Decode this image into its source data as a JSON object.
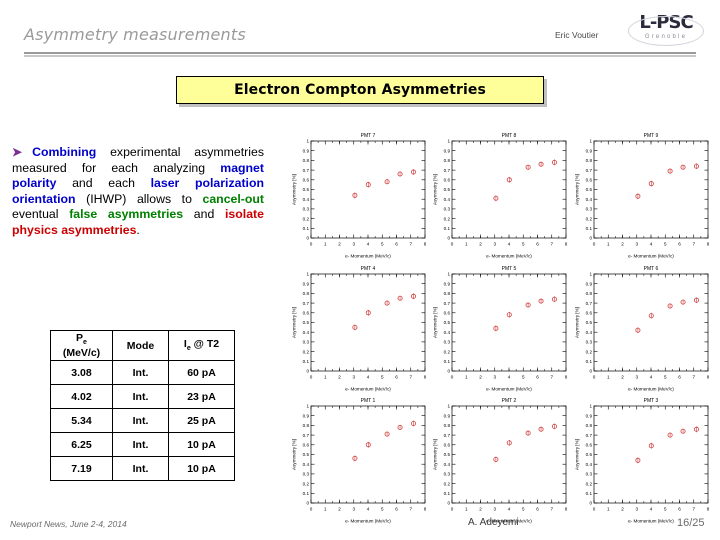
{
  "header": {
    "title": "Asymmetry measurements",
    "author": "Eric Voutier",
    "logo_main": "L-PSC",
    "logo_sub": "Grenoble"
  },
  "banner": {
    "text": "Electron Compton Asymmetries"
  },
  "paragraph": {
    "bullet": "➤",
    "seg1": "Combining",
    "seg2": " experimental asymmetries measured for each analyzing ",
    "seg3": "magnet polarity",
    "seg4": " and each ",
    "seg5": "laser polarization orientation",
    "seg6": " (IHWP) allows to ",
    "seg7": "cancel-out",
    "seg8": " eventual ",
    "seg9": "false asymmetries",
    "seg10": " and ",
    "seg11": "isolate physics asymmetries",
    "seg12": "."
  },
  "table": {
    "headers": [
      "P",
      "Mode",
      "I"
    ],
    "header_p_sub": "e",
    "header_p_unit": "(MeV/c)",
    "header_i_sub": "e",
    "header_i_rest": " @ T2",
    "rows": [
      {
        "p": "3.08",
        "mode": "Int.",
        "current": "60 pA"
      },
      {
        "p": "4.02",
        "mode": "Int.",
        "current": "23 pA"
      },
      {
        "p": "5.34",
        "mode": "Int.",
        "current": "25 pA"
      },
      {
        "p": "6.25",
        "mode": "Int.",
        "current": "10 pA"
      },
      {
        "p": "7.19",
        "mode": "Int.",
        "current": "10 pA"
      }
    ]
  },
  "chart_data": [
    {
      "type": "scatter",
      "title": "PMT 7",
      "xlabel": "e- Momentum (MeV/c)",
      "ylabel": "Asymmetry [%]",
      "xlim": [
        0,
        8
      ],
      "ylim": [
        0,
        1
      ],
      "xticks": [
        0,
        1,
        2,
        3,
        4,
        5,
        6,
        7,
        8
      ],
      "yticks": [
        0,
        0.1,
        0.2,
        0.3,
        0.4,
        0.5,
        0.6,
        0.7,
        0.8,
        0.9,
        1
      ],
      "grid": false,
      "marker_color": "#d04040",
      "x": [
        3.08,
        4.02,
        5.34,
        6.25,
        7.19
      ],
      "y": [
        0.44,
        0.55,
        0.58,
        0.66,
        0.68
      ],
      "yerr": [
        0.03,
        0.03,
        0.025,
        0.02,
        0.03
      ]
    },
    {
      "type": "scatter",
      "title": "PMT 8",
      "xlabel": "e- Momentum (MeV/c)",
      "ylabel": "Asymmetry [%]",
      "xlim": [
        0,
        8
      ],
      "ylim": [
        0,
        1
      ],
      "xticks": [
        0,
        1,
        2,
        3,
        4,
        5,
        6,
        7,
        8
      ],
      "yticks": [
        0,
        0.1,
        0.2,
        0.3,
        0.4,
        0.5,
        0.6,
        0.7,
        0.8,
        0.9,
        1
      ],
      "grid": false,
      "marker_color": "#d04040",
      "x": [
        3.08,
        4.02,
        5.34,
        6.25,
        7.19
      ],
      "y": [
        0.41,
        0.6,
        0.73,
        0.76,
        0.78
      ],
      "yerr": [
        0.03,
        0.03,
        0.025,
        0.02,
        0.03
      ]
    },
    {
      "type": "scatter",
      "title": "PMT 9",
      "xlabel": "e- Momentum (MeV/c)",
      "ylabel": "Asymmetry [%]",
      "xlim": [
        0,
        8
      ],
      "ylim": [
        0,
        1
      ],
      "xticks": [
        0,
        1,
        2,
        3,
        4,
        5,
        6,
        7,
        8
      ],
      "yticks": [
        0,
        0.1,
        0.2,
        0.3,
        0.4,
        0.5,
        0.6,
        0.7,
        0.8,
        0.9,
        1
      ],
      "grid": false,
      "marker_color": "#d04040",
      "x": [
        3.08,
        4.02,
        5.34,
        6.25,
        7.19
      ],
      "y": [
        0.43,
        0.56,
        0.69,
        0.73,
        0.74
      ],
      "yerr": [
        0.03,
        0.03,
        0.025,
        0.02,
        0.03
      ]
    },
    {
      "type": "scatter",
      "title": "PMT 4",
      "xlabel": "e- Momentum (MeV/c)",
      "ylabel": "Asymmetry [%]",
      "xlim": [
        0,
        8
      ],
      "ylim": [
        0,
        1
      ],
      "xticks": [
        0,
        1,
        2,
        3,
        4,
        5,
        6,
        7,
        8
      ],
      "yticks": [
        0,
        0.1,
        0.2,
        0.3,
        0.4,
        0.5,
        0.6,
        0.7,
        0.8,
        0.9,
        1
      ],
      "grid": false,
      "marker_color": "#d04040",
      "x": [
        3.08,
        4.02,
        5.34,
        6.25,
        7.19
      ],
      "y": [
        0.45,
        0.6,
        0.7,
        0.75,
        0.77
      ],
      "yerr": [
        0.03,
        0.03,
        0.025,
        0.02,
        0.03
      ]
    },
    {
      "type": "scatter",
      "title": "PMT 5",
      "xlabel": "e- Momentum (MeV/c)",
      "ylabel": "Asymmetry [%]",
      "xlim": [
        0,
        8
      ],
      "ylim": [
        0,
        1
      ],
      "xticks": [
        0,
        1,
        2,
        3,
        4,
        5,
        6,
        7,
        8
      ],
      "yticks": [
        0,
        0.1,
        0.2,
        0.3,
        0.4,
        0.5,
        0.6,
        0.7,
        0.8,
        0.9,
        1
      ],
      "grid": false,
      "marker_color": "#d04040",
      "x": [
        3.08,
        4.02,
        5.34,
        6.25,
        7.19
      ],
      "y": [
        0.44,
        0.58,
        0.68,
        0.72,
        0.74
      ],
      "yerr": [
        0.03,
        0.03,
        0.025,
        0.02,
        0.03
      ]
    },
    {
      "type": "scatter",
      "title": "PMT 6",
      "xlabel": "e- Momentum (MeV/c)",
      "ylabel": "Asymmetry [%]",
      "xlim": [
        0,
        8
      ],
      "ylim": [
        0,
        1
      ],
      "xticks": [
        0,
        1,
        2,
        3,
        4,
        5,
        6,
        7,
        8
      ],
      "yticks": [
        0,
        0.1,
        0.2,
        0.3,
        0.4,
        0.5,
        0.6,
        0.7,
        0.8,
        0.9,
        1
      ],
      "grid": false,
      "marker_color": "#d04040",
      "x": [
        3.08,
        4.02,
        5.34,
        6.25,
        7.19
      ],
      "y": [
        0.42,
        0.57,
        0.67,
        0.71,
        0.73
      ],
      "yerr": [
        0.03,
        0.03,
        0.025,
        0.02,
        0.03
      ]
    },
    {
      "type": "scatter",
      "title": "PMT 1",
      "xlabel": "e- Momentum (MeV/c)",
      "ylabel": "Asymmetry [%]",
      "xlim": [
        0,
        8
      ],
      "ylim": [
        0,
        1
      ],
      "xticks": [
        0,
        1,
        2,
        3,
        4,
        5,
        6,
        7,
        8
      ],
      "yticks": [
        0,
        0.1,
        0.2,
        0.3,
        0.4,
        0.5,
        0.6,
        0.7,
        0.8,
        0.9,
        1
      ],
      "grid": false,
      "marker_color": "#d04040",
      "x": [
        3.08,
        4.02,
        5.34,
        6.25,
        7.19
      ],
      "y": [
        0.46,
        0.6,
        0.71,
        0.78,
        0.82
      ],
      "yerr": [
        0.03,
        0.03,
        0.025,
        0.02,
        0.03
      ]
    },
    {
      "type": "scatter",
      "title": "PMT 2",
      "xlabel": "e- Momentum (MeV/c)",
      "ylabel": "Asymmetry [%]",
      "xlim": [
        0,
        8
      ],
      "ylim": [
        0,
        1
      ],
      "xticks": [
        0,
        1,
        2,
        3,
        4,
        5,
        6,
        7,
        8
      ],
      "yticks": [
        0,
        0.1,
        0.2,
        0.3,
        0.4,
        0.5,
        0.6,
        0.7,
        0.8,
        0.9,
        1
      ],
      "grid": false,
      "marker_color": "#d04040",
      "x": [
        3.08,
        4.02,
        5.34,
        6.25,
        7.19
      ],
      "y": [
        0.45,
        0.62,
        0.72,
        0.76,
        0.79
      ],
      "yerr": [
        0.03,
        0.03,
        0.025,
        0.02,
        0.03
      ]
    },
    {
      "type": "scatter",
      "title": "PMT 3",
      "xlabel": "e- Momentum (MeV/c)",
      "ylabel": "Asymmetry [%]",
      "xlim": [
        0,
        8
      ],
      "ylim": [
        0,
        1
      ],
      "xticks": [
        0,
        1,
        2,
        3,
        4,
        5,
        6,
        7,
        8
      ],
      "yticks": [
        0,
        0.1,
        0.2,
        0.3,
        0.4,
        0.5,
        0.6,
        0.7,
        0.8,
        0.9,
        1
      ],
      "grid": false,
      "marker_color": "#d04040",
      "x": [
        3.08,
        4.02,
        5.34,
        6.25,
        7.19
      ],
      "y": [
        0.44,
        0.59,
        0.7,
        0.74,
        0.76
      ],
      "yerr": [
        0.03,
        0.03,
        0.025,
        0.02,
        0.03
      ]
    }
  ],
  "footer": {
    "left": "Newport News, June 2-4, 2014",
    "center": "A. Adeyemi",
    "right": "16/25"
  }
}
